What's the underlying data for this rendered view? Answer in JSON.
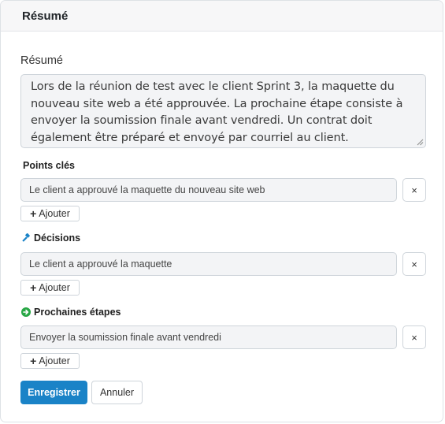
{
  "header": {
    "title": "Résumé"
  },
  "summary": {
    "label": "Résumé",
    "text": "Lors de la réunion de test avec le client Sprint 3, la maquette du nouveau site web a été approuvée. La prochaine étape consiste à envoyer la soumission finale avant vendredi. Un contrat doit également être préparé et envoyé par courriel au client."
  },
  "key_points": {
    "label": "Points clés",
    "items": [
      "Le client a approuvé la maquette du nouveau site web"
    ],
    "add_label": "Ajouter",
    "remove_label": "×"
  },
  "decisions": {
    "label": "Décisions",
    "icon": "hammer-icon",
    "icon_color": "#1a83c7",
    "items": [
      "Le client a approuvé la maquette"
    ],
    "add_label": "Ajouter",
    "remove_label": "×"
  },
  "next_steps": {
    "label": "Prochaines étapes",
    "icon": "arrow-circle-right-icon",
    "icon_color": "#28a745",
    "items": [
      "Envoyer la soumission finale avant vendredi"
    ],
    "add_label": "Ajouter",
    "remove_label": "×"
  },
  "actions": {
    "save_label": "Enregistrer",
    "save_color": "#1a83c7",
    "cancel_label": "Annuler"
  }
}
